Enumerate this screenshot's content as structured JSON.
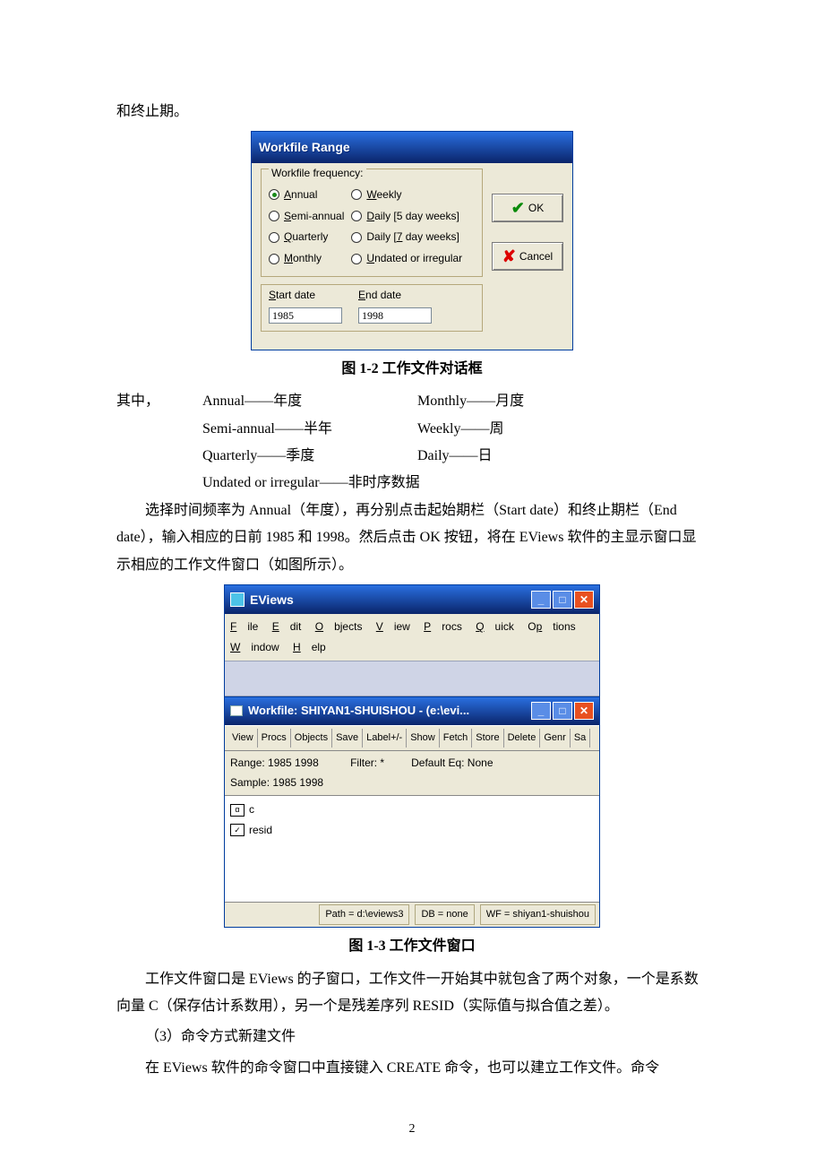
{
  "intro_line": "和终止期。",
  "dialog1": {
    "title": "Workfile Range",
    "group_label": "Workfile frequency:",
    "radios_left": [
      {
        "label": "Annual",
        "underline": "A",
        "checked": true
      },
      {
        "label": "Semi-annual",
        "underline": "S",
        "checked": false
      },
      {
        "label": "Quarterly",
        "underline": "Q",
        "checked": false
      },
      {
        "label": "Monthly",
        "underline": "M",
        "checked": false
      }
    ],
    "radios_right": [
      {
        "label": "Weekly",
        "underline": "W",
        "checked": false
      },
      {
        "label": "Daily [5 day weeks]",
        "underline": "D",
        "checked": false
      },
      {
        "label": "Daily [7 day weeks]",
        "underline": "",
        "checked": false
      },
      {
        "label": "Undated or irregular",
        "underline": "U",
        "checked": false
      }
    ],
    "start_label": "Start date",
    "start_underline": "S",
    "start_value": "1985",
    "end_label": "End date",
    "end_underline": "E",
    "end_value": "1998",
    "ok_label": "OK",
    "cancel_label": "Cancel"
  },
  "caption1": "图 1-2 工作文件对话框",
  "defs_intro": "其中，",
  "defs": {
    "r0a": "Annual——年度",
    "r0b": "Monthly——月度",
    "r1a": "Semi-annual——半年",
    "r1b": "Weekly——周",
    "r2a": "Quarterly——季度",
    "r2b": "Daily——日",
    "r3": "Undated or irregular——非时序数据"
  },
  "para_after_defs": "选择时间频率为 Annual（年度），再分别点击起始期栏（Start date）和终止期栏（End date），输入相应的日前 1985 和 1998。然后点击 OK 按钮，将在 EViews 软件的主显示窗口显示相应的工作文件窗口（如图所示）。",
  "win2": {
    "app_title": "EViews",
    "menus": [
      "File",
      "Edit",
      "Objects",
      "View",
      "Procs",
      "Quick",
      "Options",
      "Window",
      "Help"
    ],
    "inner_title": "Workfile: SHIYAN1-SHUISHOU - (e:\\evi...",
    "toolbar": [
      "View",
      "Procs",
      "Objects",
      "Save",
      "Label+/-",
      "Show",
      "Fetch",
      "Store",
      "Delete",
      "Genr",
      "Sa"
    ],
    "info": {
      "range": "Range:  1985 1998",
      "sample": "Sample: 1985 1998",
      "filter": "Filter: *",
      "defeq": "Default Eq: None"
    },
    "objects": [
      {
        "icon": "α",
        "name": "c"
      },
      {
        "icon": "✓",
        "name": "resid"
      }
    ],
    "status": {
      "path": "Path = d:\\eviews3",
      "db": "DB = none",
      "wf": "WF = shiyan1-shuishou"
    }
  },
  "caption2": "图 1-3 工作文件窗口",
  "para_after_win": "工作文件窗口是 EViews 的子窗口，工作文件一开始其中就包含了两个对象，一个是系数向量 C（保存估计系数用），另一个是残差序列 RESID（实际值与拟合值之差）。",
  "para3": "（3）命令方式新建文件",
  "para4": "在 EViews 软件的命令窗口中直接键入 CREATE 命令，也可以建立工作文件。命令",
  "pagenum": "2"
}
